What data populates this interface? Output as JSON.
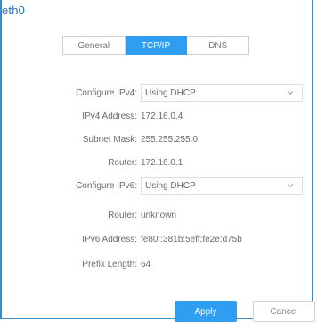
{
  "window": {
    "title": "eth0"
  },
  "tabs": [
    {
      "label": "General",
      "active": false
    },
    {
      "label": "TCP/IP",
      "active": true
    },
    {
      "label": "DNS",
      "active": false
    }
  ],
  "form": {
    "configure_ipv4": {
      "label": "Configure IPv4:",
      "value": "Using DHCP"
    },
    "ipv4_address": {
      "label": "IPv4 Address:",
      "value": "172.16.0.4"
    },
    "subnet_mask": {
      "label": "Subnet Mask:",
      "value": "255.255.255.0"
    },
    "router": {
      "label": "Router:",
      "value": "172.16.0.1"
    },
    "configure_ipv6": {
      "label": "Configure IPv6:",
      "value": "Using DHCP"
    },
    "router_v6": {
      "label": "Router:",
      "value": "unknown"
    },
    "ipv6_address": {
      "label": "IPv6 Address:",
      "value": "fe80::381b:5eff:fe2e:d75b"
    },
    "prefix_length": {
      "label": "Prefix Length:",
      "value": "64"
    }
  },
  "buttons": {
    "apply": "Apply",
    "cancel": "Cancel"
  },
  "colors": {
    "accent": "#2f9df2",
    "border_accent": "#3a8cc9",
    "title": "#2a6db7"
  },
  "icons": {
    "dropdown": "chevron-down-icon"
  }
}
